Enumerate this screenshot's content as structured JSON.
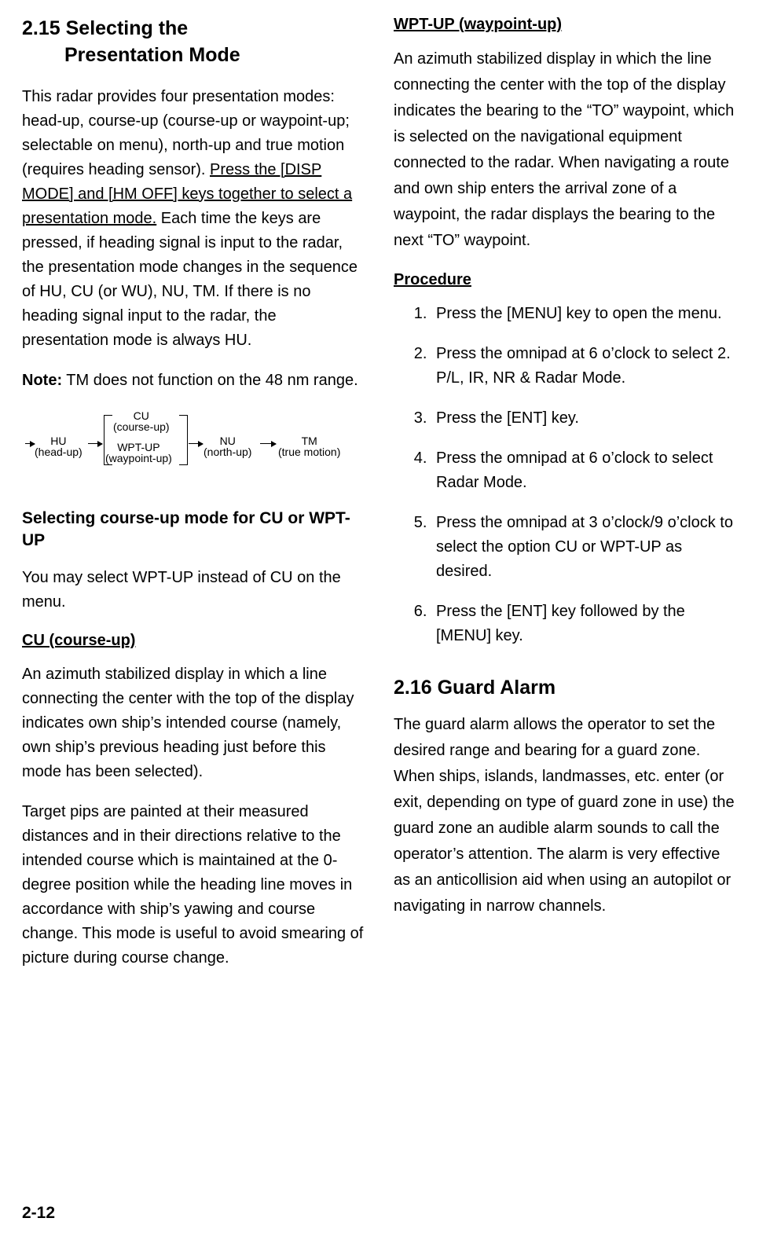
{
  "footer": "2-12",
  "left": {
    "section_num": "2.15",
    "section_title_l1": "Selecting the",
    "section_title_l2": "Presentation Mode",
    "p1_a": "This radar provides four presentation modes: head-up, course-up (course-up or waypoint-up; selectable on menu), north-up and true motion (requires heading sensor). ",
    "p1_u": "Press the [DISP MODE] and [HM OFF] keys together to select a presentation mode.",
    "p1_b": " Each time the keys are pressed, if heading signal is input to the radar, the presentation mode changes in the sequence of HU, CU (or WU), NU, TM. If there is no heading signal input to the radar, the presentation mode is always HU.",
    "note_label": "Note:",
    "note_body": " TM does not function on the 48 nm range.",
    "diagram": {
      "hu_t": "HU",
      "hu_b": "(head-up)",
      "cu_t": "CU",
      "cu_b": "(course-up)",
      "wpt_t": "WPT-UP",
      "wpt_b": "(waypoint-up)",
      "nu_t": "NU",
      "nu_b": "(north-up)",
      "tm_t": "TM",
      "tm_b": "(true motion)"
    },
    "subh": "Selecting course-up mode for CU or WPT-UP",
    "p2": "You may select WPT-UP instead of CU on the menu.",
    "cu_h": "CU (course-up)",
    "cu_p1": "An azimuth stabilized display in which a line connecting the center with the top of the display indicates own ship’s intended course (namely, own ship’s previous heading just before this mode has been selected).",
    "cu_p2": "Target pips are painted at their measured distances and in their directions relative to the intended course which is maintained at the 0-degree position while the heading line moves in accordance with ship’s yawing and course change. This mode is useful to avoid smearing of picture during course change."
  },
  "right": {
    "wpt_h": "WPT-UP (waypoint-up)",
    "wpt_p": "An azimuth stabilized display in which the line connecting the center with the top of the display indicates the bearing to the “TO” waypoint, which is selected on the navigational equipment connected to the radar. When navigating a route and own ship enters the arrival zone of a waypoint, the radar displays the bearing to the next “TO” waypoint.",
    "proc_h": "Procedure",
    "steps": [
      "Press the [MENU] key to open the menu.",
      "Press the omnipad at 6 o’clock to select 2. P/L, IR, NR & Radar Mode.",
      "Press the [ENT] key.",
      "Press the omnipad at 6 o’clock to select Radar Mode.",
      "Press the omnipad at 3 o’clock/9 o’clock to select the option CU or WPT-UP as desired.",
      "Press the [ENT] key followed by the [MENU] key."
    ],
    "section2_h": "2.16 Guard Alarm",
    "section2_p": "The guard alarm allows the operator to set the desired range and bearing for a guard zone. When ships, islands, landmasses, etc. enter (or exit, depending on type of guard zone in use) the guard zone an audible alarm sounds to call the operator’s attention. The alarm is very effective as an anticollision aid when using an autopilot or navigating in narrow channels."
  }
}
